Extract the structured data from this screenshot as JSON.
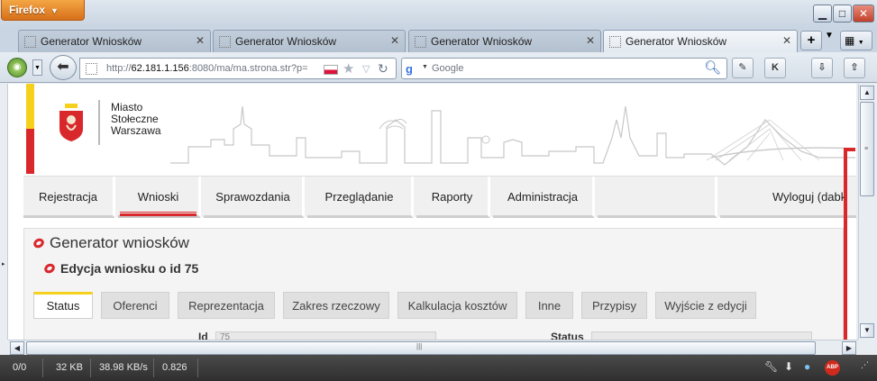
{
  "browser": {
    "app_button": "Firefox",
    "window_controls": {
      "minimize": "▁",
      "maximize": "□",
      "close": "✕"
    },
    "tabs": [
      {
        "title": "Generator Wniosków"
      },
      {
        "title": "Generator Wniosków"
      },
      {
        "title": "Generator Wniosków"
      },
      {
        "title": "Generator Wniosków"
      }
    ],
    "active_tab": 3,
    "url": {
      "scheme": "http://",
      "host": "62.181.1.156",
      "rest": ":8080/ma/ma.strona.str?p="
    },
    "search": {
      "engine": "Google",
      "placeholder": "Google"
    }
  },
  "page": {
    "city": {
      "line1": "Miasto",
      "line2": "Stołeczne",
      "line3": "Warszawa"
    },
    "menu": [
      {
        "label": "Rejestracja"
      },
      {
        "label": "Wnioski",
        "active": true
      },
      {
        "label": "Sprawozdania"
      },
      {
        "label": "Przeglądanie"
      },
      {
        "label": "Raporty"
      },
      {
        "label": "Administracja"
      },
      {
        "label": ""
      },
      {
        "label": "Wyloguj (dabk"
      }
    ],
    "panel_title": "Generator wniosków",
    "panel_subtitle": "Edycja wniosku o id 75",
    "subtabs": [
      {
        "label": "Status",
        "active": true
      },
      {
        "label": "Oferenci"
      },
      {
        "label": "Reprezentacja"
      },
      {
        "label": "Zakres rzeczowy"
      },
      {
        "label": "Kalkulacja kosztów"
      },
      {
        "label": "Inne"
      },
      {
        "label": "Przypisy"
      },
      {
        "label": "Wyjście z edycji"
      }
    ],
    "fields": {
      "id_label": "Id",
      "id_value": "75",
      "status_label": "Status"
    }
  },
  "statusbar": {
    "count": "0/0",
    "size": "32 KB",
    "speed": "38.98 KB/s",
    "time": "0.826",
    "abp": "ABP"
  },
  "colors": {
    "warsaw_red": "#d9282c",
    "warsaw_yellow": "#f5d11d",
    "firefox_orange": "#e6822c"
  }
}
